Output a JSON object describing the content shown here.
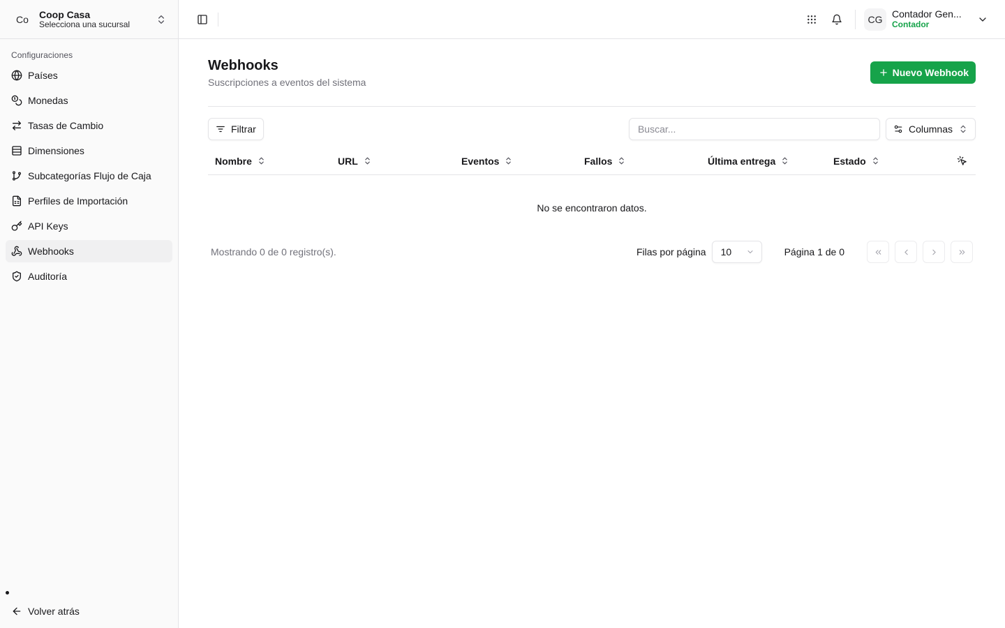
{
  "org": {
    "initials": "Co",
    "name": "Coop Casa",
    "subtitle": "Selecciona una sucursal"
  },
  "sidebar": {
    "group_label": "Configuraciones",
    "items": [
      {
        "label": "Países",
        "icon": "globe-icon"
      },
      {
        "label": "Monedas",
        "icon": "coins-icon"
      },
      {
        "label": "Tasas de Cambio",
        "icon": "arrows-exchange-icon"
      },
      {
        "label": "Dimensiones",
        "icon": "layers-icon"
      },
      {
        "label": "Subcategorías Flujo de Caja",
        "icon": "git-branch-icon"
      },
      {
        "label": "Perfiles de Importación",
        "icon": "file-sheet-icon"
      },
      {
        "label": "API Keys",
        "icon": "key-icon"
      },
      {
        "label": "Webhooks",
        "icon": "webhook-icon",
        "active": true
      },
      {
        "label": "Auditoría",
        "icon": "shield-check-icon"
      }
    ],
    "back_label": "Volver atrás"
  },
  "user": {
    "initials": "CG",
    "name": "Contador Gen...",
    "role": "Contador"
  },
  "page": {
    "title": "Webhooks",
    "subtitle": "Suscripciones a eventos del sistema",
    "new_button": "Nuevo Webhook"
  },
  "toolbar": {
    "filter_label": "Filtrar",
    "search_placeholder": "Buscar...",
    "columns_label": "Columnas"
  },
  "table": {
    "columns": [
      "Nombre",
      "URL",
      "Eventos",
      "Fallos",
      "Última entrega",
      "Estado"
    ],
    "empty_text": "No se encontraron datos."
  },
  "pagination": {
    "summary": "Mostrando 0 de 0 registro(s).",
    "rows_label": "Filas por página",
    "rows_value": "10",
    "page_text": "Página 1 de 0"
  },
  "colors": {
    "accent": "#16a34a",
    "border": "#e4e4e7",
    "sidebar_bg": "#fafafa"
  }
}
